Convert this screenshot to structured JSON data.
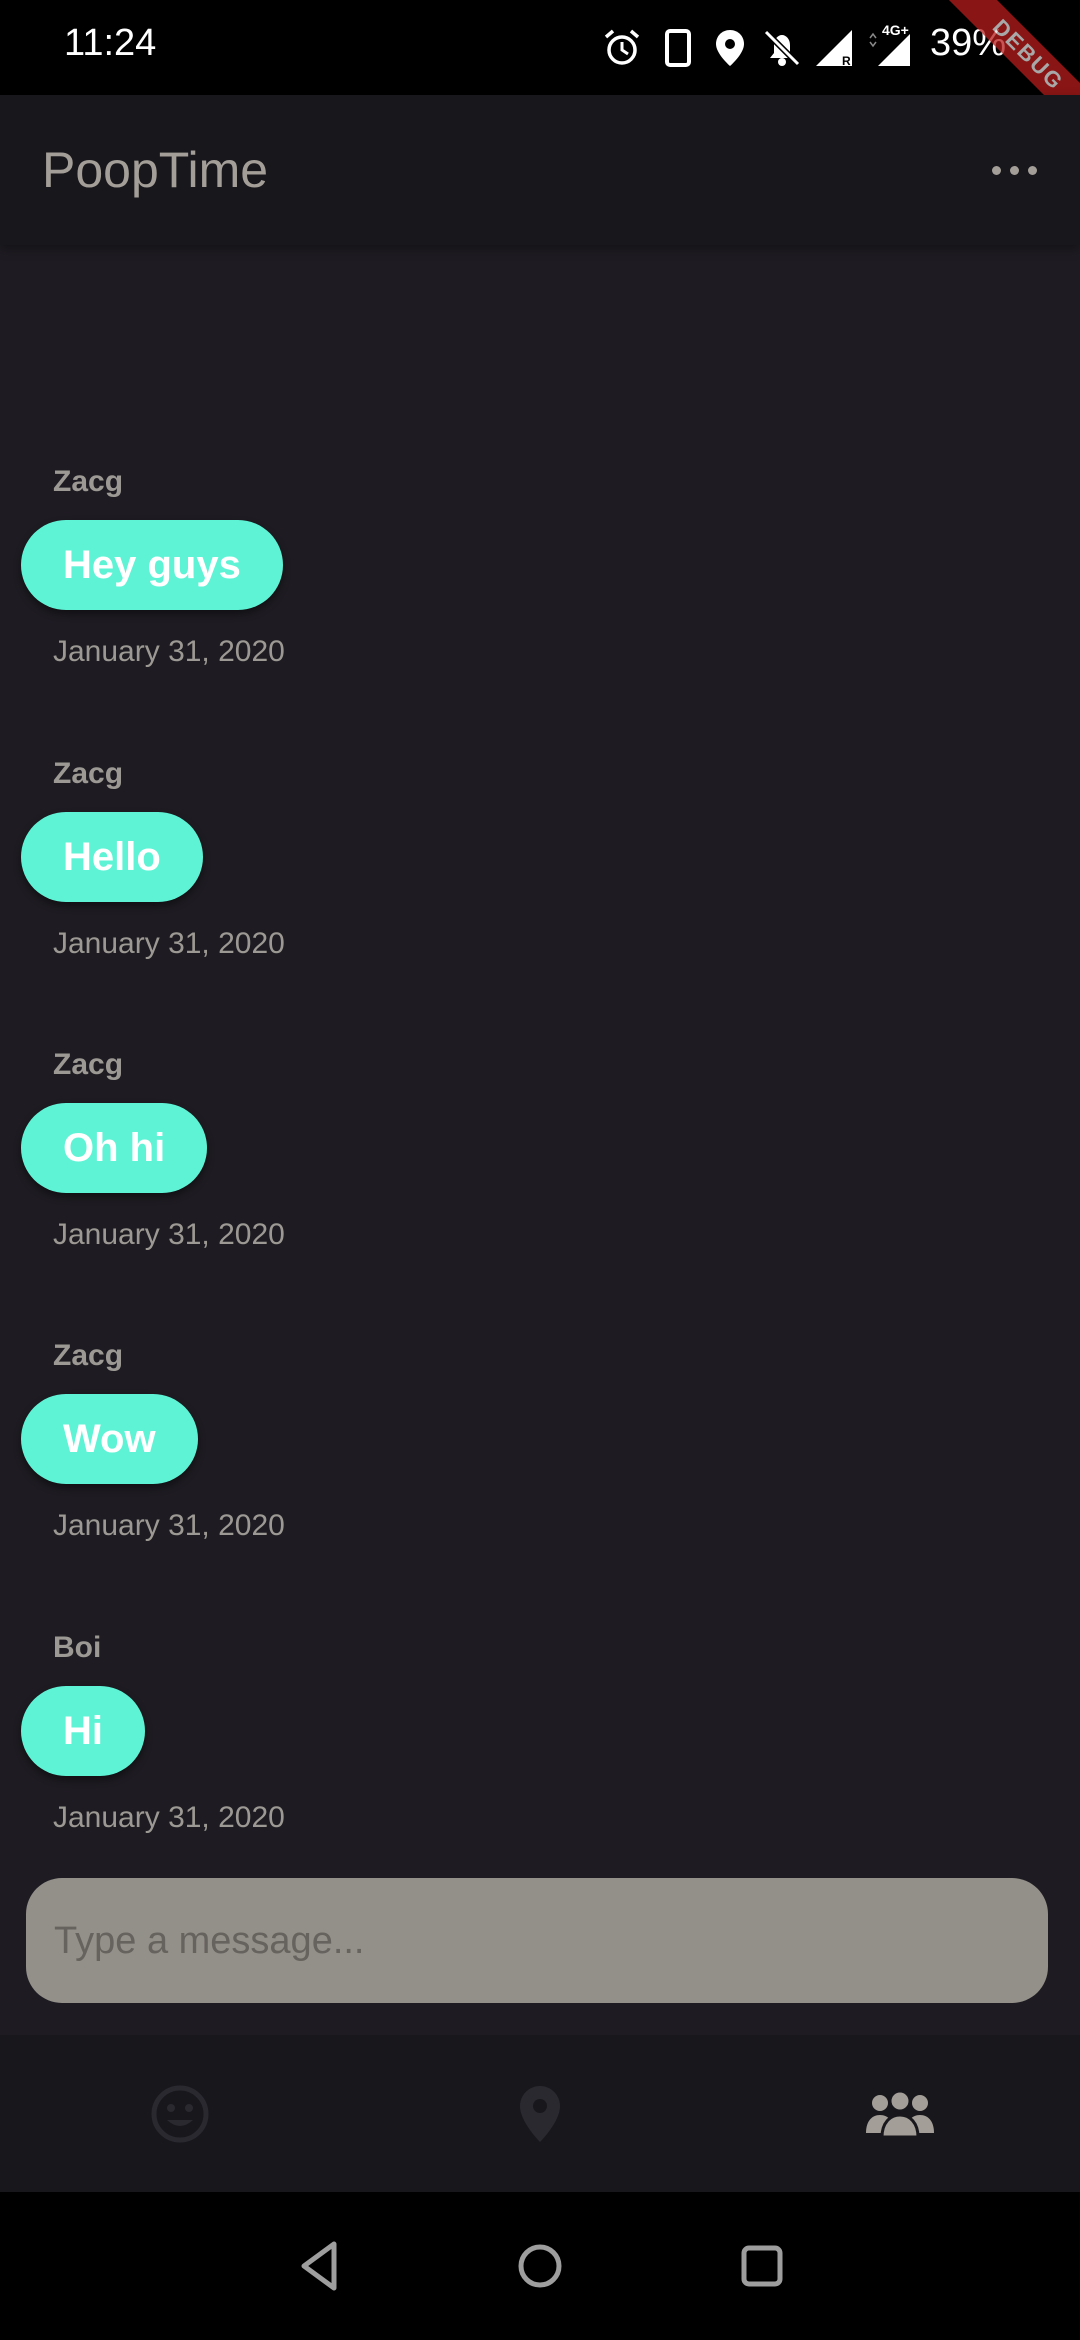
{
  "status_bar": {
    "time": "11:24",
    "battery": "39%",
    "network_label": "4G+",
    "icons": [
      "alarm-icon",
      "phone-icon",
      "location-icon",
      "bell-off-icon",
      "signal-icon",
      "signal-4g-icon"
    ]
  },
  "debug_banner": {
    "label": "DEBUG"
  },
  "app_bar": {
    "title": "PoopTime"
  },
  "messages": [
    {
      "sender": "Zacg",
      "text": "Hey guys",
      "date": "January 31, 2020"
    },
    {
      "sender": "Zacg",
      "text": "Hello",
      "date": "January 31, 2020"
    },
    {
      "sender": "Zacg",
      "text": "Oh hi",
      "date": "January 31, 2020"
    },
    {
      "sender": "Zacg",
      "text": "Wow",
      "date": "January 31, 2020"
    },
    {
      "sender": "Boi",
      "text": "Hi",
      "date": "January 31, 2020"
    }
  ],
  "composer": {
    "placeholder": "Type a message..."
  },
  "bottom_nav": {
    "items": [
      {
        "icon": "smiley-icon",
        "active": false
      },
      {
        "icon": "location-pin-icon",
        "active": false
      },
      {
        "icon": "group-icon",
        "active": true
      }
    ]
  },
  "colors": {
    "background": "#1e1c22",
    "app_bar": "#18171c",
    "bubble": "#5ff3d6",
    "muted_text": "#9c9893",
    "input": "#938f89"
  }
}
